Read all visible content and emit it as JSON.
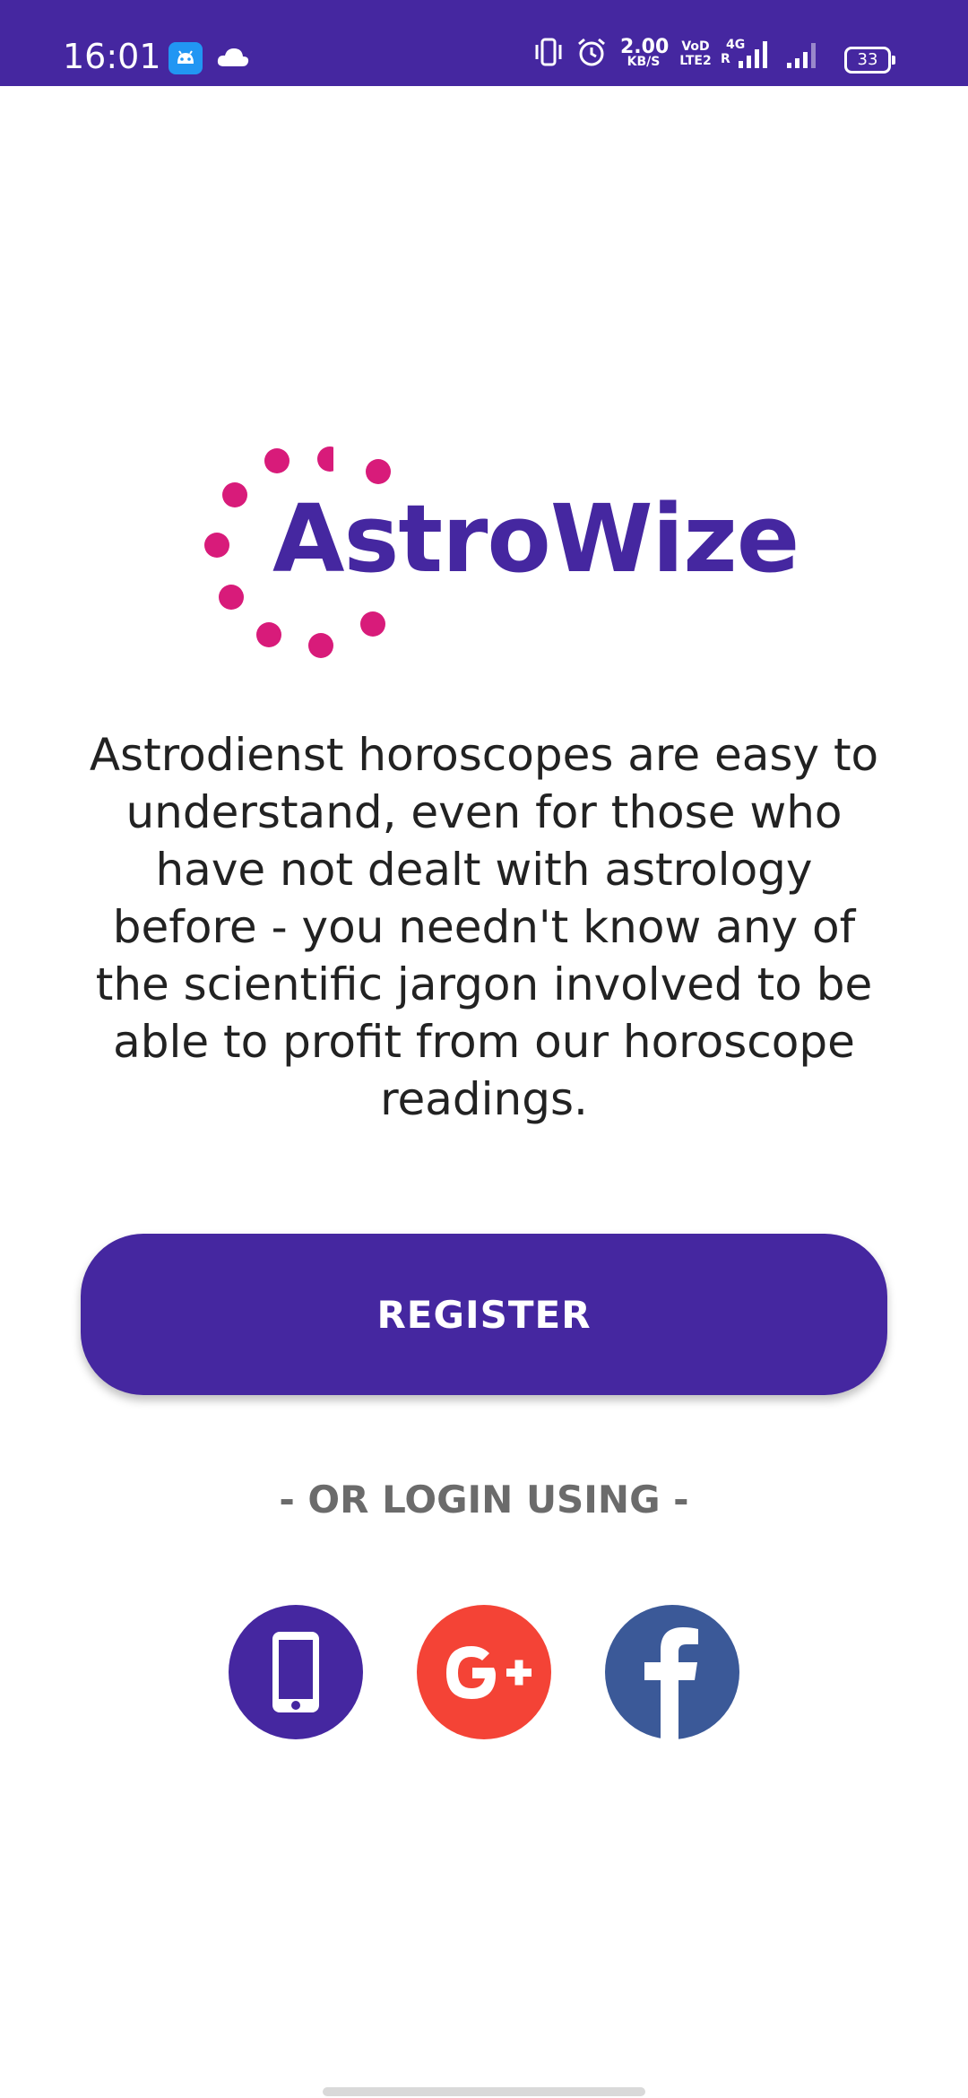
{
  "status_bar": {
    "time": "16:01",
    "net_speed_value": "2.00",
    "net_speed_unit": "KB/S",
    "volte_top": "VoD",
    "volte_bottom": "LTE2",
    "network_type": "4G",
    "roaming": "R",
    "battery": "33",
    "icons": [
      "android-icon",
      "cloud-icon",
      "vibrate-icon",
      "alarm-icon",
      "signal-icon",
      "signal-icon",
      "battery-icon"
    ]
  },
  "logo": {
    "text": "AstroWize",
    "text_color": "#4527A0",
    "dot_color": "#D81B7A"
  },
  "description": "Astrodienst horoscopes are easy to understand, even for those who have not dealt with astrology before - you needn't know any of the scientific jargon involved to be able to profit from our horoscope readings.",
  "register": {
    "label": "REGISTER",
    "color": "#4527A0"
  },
  "login_divider": "- OR LOGIN USING -",
  "social_logins": [
    {
      "name": "phone",
      "icon": "phone-icon",
      "color": "#4527A0"
    },
    {
      "name": "google-plus",
      "icon": "google-plus-icon",
      "color": "#F44336"
    },
    {
      "name": "facebook",
      "icon": "facebook-icon",
      "color": "#3B5998"
    }
  ]
}
